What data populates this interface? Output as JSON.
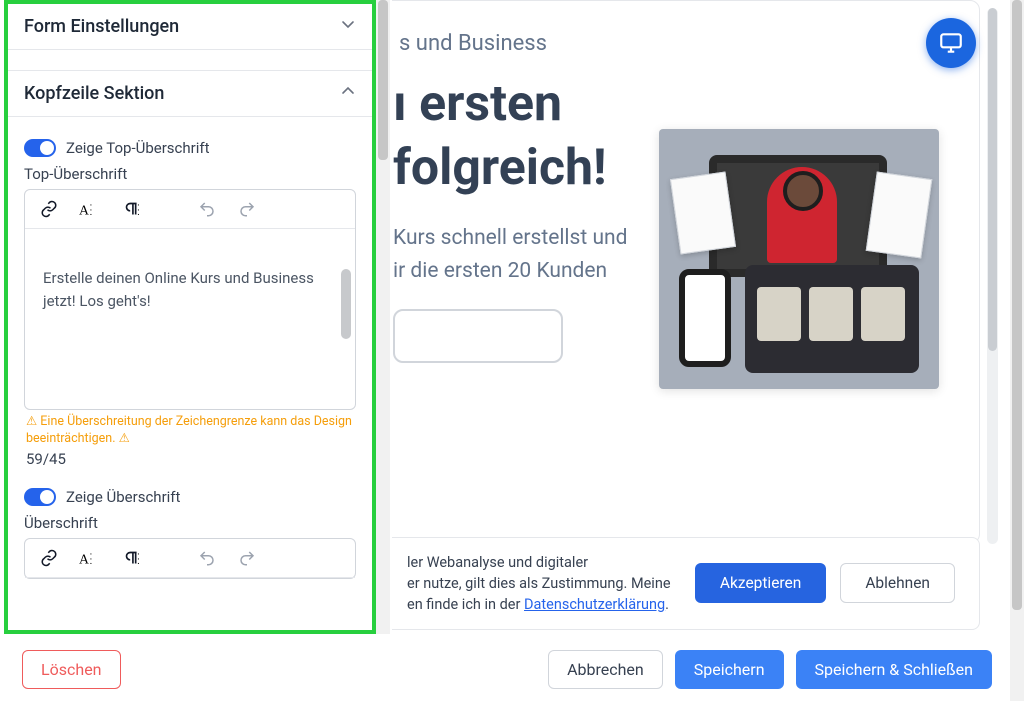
{
  "sidebar": {
    "sections": {
      "form_settings": {
        "title": "Form Einstellungen"
      },
      "header_section": {
        "title": "Kopfzeile Sektion",
        "show_top_heading_label": "Zeige Top-Überschrift",
        "top_heading_label": "Top-Überschrift",
        "top_heading_value": "Erstelle deinen Online Kurs und Business jetzt! Los geht's!",
        "warning": "⚠ Eine Überschreitung der Zeichengrenze kann das Design beeinträchtigen. ⚠",
        "counter": "59/45",
        "show_heading_label": "Zeige Überschrift",
        "heading_label": "Überschrift"
      }
    }
  },
  "preview": {
    "top_heading_fragment": "s und Business",
    "heading_line1": "ı ersten",
    "heading_line2": "folgreich!",
    "sub_line1": "Kurs schnell erstellst und",
    "sub_line2": "ir die ersten 20 Kunden"
  },
  "cookie": {
    "line1": "ler Webanalyse und digitaler",
    "line2": "er nutze, gilt dies als Zustimmung. Meine",
    "line3_a": "en finde ich in der ",
    "link": "Datenschutzerklärung",
    "line3_b": ".",
    "accept": "Akzeptieren",
    "deny": "Ablehnen"
  },
  "footer": {
    "delete": "Löschen",
    "cancel": "Abbrechen",
    "save": "Speichern",
    "save_close": "Speichern & Schließen"
  }
}
